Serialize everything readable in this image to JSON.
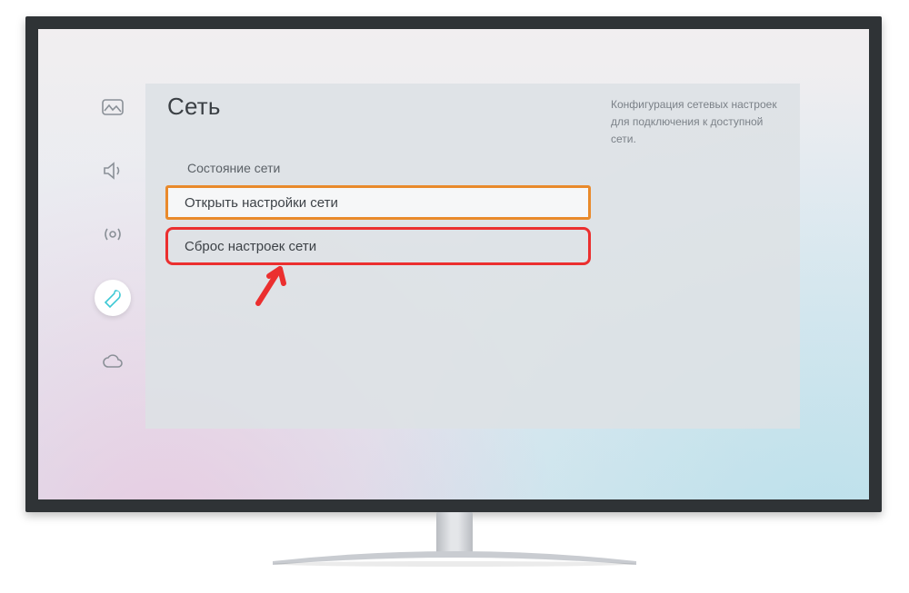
{
  "panel": {
    "title": "Сеть",
    "description": "Конфигурация сетевых настроек для подключения к доступной сети."
  },
  "items": {
    "status": "Состояние сети",
    "open": "Открыть настройки сети",
    "reset": "Сброс настроек сети"
  },
  "sidebar": {
    "picture": "picture-icon",
    "sound": "sound-icon",
    "broadcast": "broadcast-icon",
    "general": "general-icon",
    "support": "support-icon"
  }
}
